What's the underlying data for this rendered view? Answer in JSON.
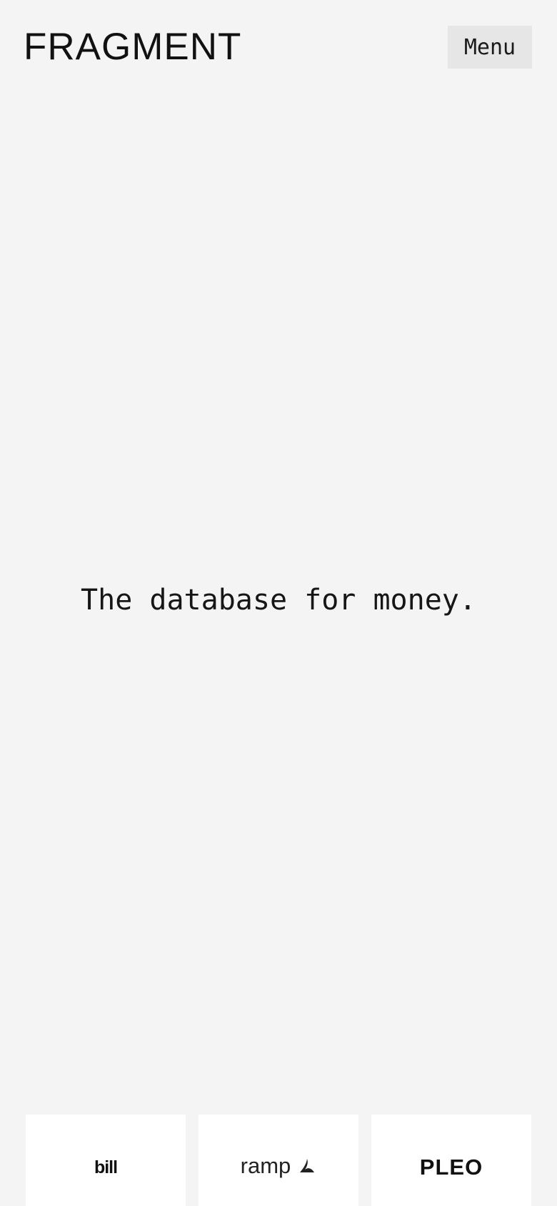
{
  "header": {
    "logo_text": "FRAGMENT",
    "menu_label": "Menu"
  },
  "hero": {
    "tagline": "The database for money."
  },
  "customers": {
    "logos": [
      {
        "name": "bill"
      },
      {
        "name": "ramp"
      },
      {
        "name": "PLEO"
      }
    ]
  },
  "colors": {
    "background": "#f4f4f4",
    "menu_background": "#e6e6e6",
    "card_background": "#ffffff",
    "text": "#111111"
  }
}
